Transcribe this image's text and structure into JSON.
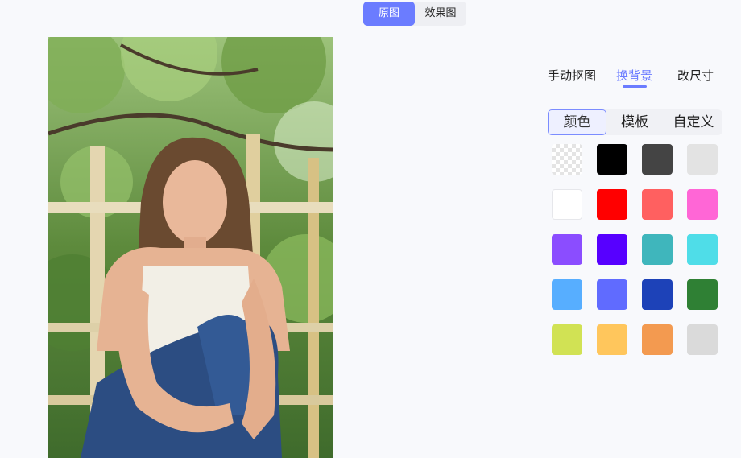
{
  "view_toggle": {
    "original": "原图",
    "result": "效果图",
    "active": "original"
  },
  "tabs": [
    {
      "label": "手动抠图",
      "active": false
    },
    {
      "label": "换背景",
      "active": true
    },
    {
      "label": "改尺寸",
      "active": false
    }
  ],
  "background_mode": [
    {
      "label": "颜色",
      "active": true
    },
    {
      "label": "模板",
      "active": false
    },
    {
      "label": "自定义",
      "active": false
    }
  ],
  "swatches": [
    [
      "transparent",
      "#000000",
      "#444444",
      "#e3e3e3"
    ],
    [
      "#ffffff",
      "#ff0000",
      "#ff6060",
      "#ff66d6"
    ],
    [
      "#8b4dff",
      "#5700ff",
      "#3fb6bc",
      "#4fdde8"
    ],
    [
      "#57aeff",
      "#606bff",
      "#1d42b8",
      "#2f8034"
    ],
    [
      "#d1e254",
      "#ffc65c",
      "#f39a50",
      "#dadada"
    ]
  ],
  "colors": {
    "accent": "#6b7cff",
    "page_bg": "#f8f9fc"
  }
}
